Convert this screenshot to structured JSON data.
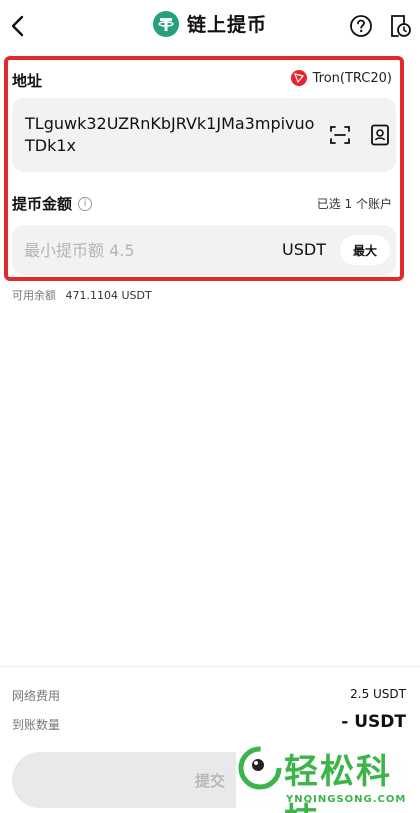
{
  "header": {
    "title": "链上提币",
    "coin_icon": "tether-icon",
    "back_icon": "chevron-left-icon",
    "help_icon": "question-circle-icon",
    "history_icon": "history-icon"
  },
  "address": {
    "label": "地址",
    "network": "Tron(TRC20)",
    "value": "TLguwk32UZRnKbJRVk1JMa3mpivuoTDk1x",
    "scan_icon": "scan-icon",
    "book_icon": "address-book-icon"
  },
  "amount": {
    "label": "提币金额",
    "selected_accounts": "已选 1 个账户",
    "placeholder": "最小提币额 4.5",
    "unit": "USDT",
    "max_label": "最大"
  },
  "available": {
    "label": "可用余额",
    "value": "471.1104 USDT"
  },
  "summary": {
    "fee_label": "网络费用",
    "fee_value": "2.5 USDT",
    "receive_label": "到账数量",
    "receive_value": "- USDT"
  },
  "submit_label": "提交",
  "watermark": {
    "text": "轻松科技",
    "url": "YNQINGSONG.COM"
  },
  "colors": {
    "highlight": "#e12b2b",
    "tether": "#26a17b",
    "tron": "#e7262c",
    "watermark": "#3cb44a"
  }
}
